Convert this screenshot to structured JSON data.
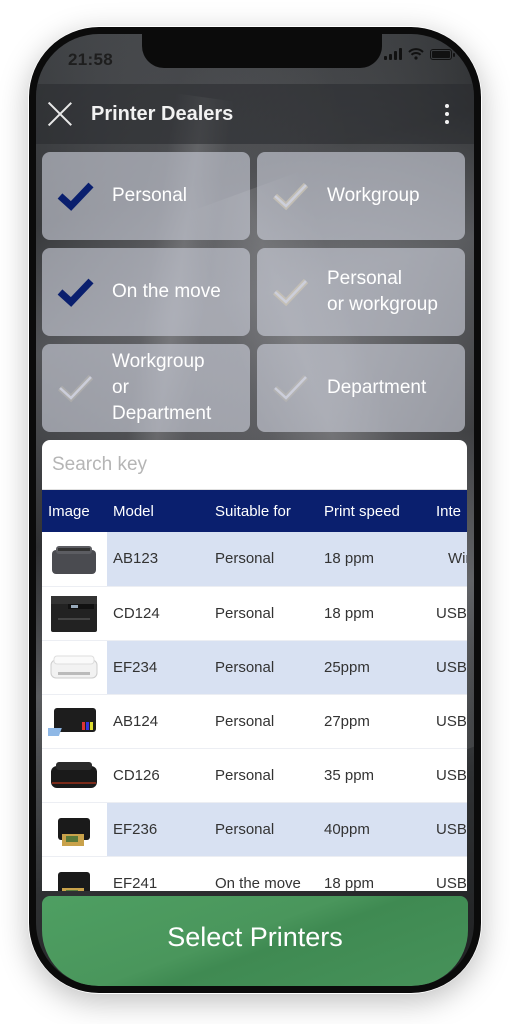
{
  "status_bar": {
    "time": "21:58",
    "icons": [
      "signal-icon",
      "wifi-icon",
      "battery-icon"
    ]
  },
  "header": {
    "title": "Printer Dealers",
    "close_icon": "close-icon",
    "menu_icon": "more-vertical-icon"
  },
  "filters": [
    {
      "label": "Personal",
      "checked": true
    },
    {
      "label": "Workgroup",
      "checked": false
    },
    {
      "label": "On the move",
      "checked": true
    },
    {
      "label": "Personal\nor workgroup",
      "checked": false
    },
    {
      "label": "Workgroup\nor\nDepartment",
      "checked": false
    },
    {
      "label": "Department",
      "checked": false
    }
  ],
  "search": {
    "placeholder": "Search key",
    "value": ""
  },
  "table": {
    "columns": [
      "Image",
      "Model",
      "Suitable for",
      "Print speed",
      "Inte"
    ],
    "rows": [
      {
        "image": "printer-laser-compact-icon",
        "model": "AB123",
        "suitable_for": "Personal",
        "print_speed": "18 ppm",
        "interface": "Wir",
        "highlighted": true
      },
      {
        "image": "printer-multifunction-icon",
        "model": "CD124",
        "suitable_for": "Personal",
        "print_speed": "18 ppm",
        "interface": "USB",
        "highlighted": false
      },
      {
        "image": "printer-inkjet-white-icon",
        "model": "EF234",
        "suitable_for": "Personal",
        "print_speed": "25ppm",
        "interface": "USB",
        "highlighted": true
      },
      {
        "image": "printer-inktank-icon",
        "model": "AB124",
        "suitable_for": "Personal",
        "print_speed": "27ppm",
        "interface": "USB",
        "highlighted": false
      },
      {
        "image": "printer-photo-icon",
        "model": "CD126",
        "suitable_for": "Personal",
        "print_speed": "35 ppm",
        "interface": "USB",
        "highlighted": false
      },
      {
        "image": "printer-photo-compact-icon",
        "model": "EF236",
        "suitable_for": "Personal",
        "print_speed": "40ppm",
        "interface": "USB",
        "highlighted": true
      },
      {
        "image": "printer-photo-compact-icon",
        "model": "EF241",
        "suitable_for": "On the move",
        "print_speed": "18 ppm",
        "interface": "USB",
        "highlighted": false
      }
    ]
  },
  "action": {
    "label": "Select Printers"
  },
  "colors": {
    "header_bg": "#0a1f6e",
    "row_highlight": "#d8e1f2",
    "check_on": "#0a1f6e",
    "check_off": "#c9c3b5",
    "button_green": "#4a965c"
  }
}
